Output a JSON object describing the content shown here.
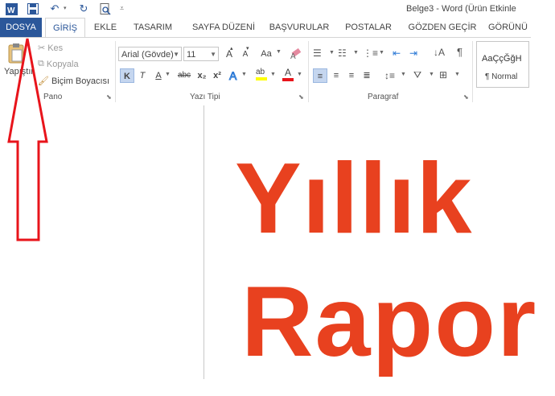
{
  "window": {
    "title": "Belge3 - Word (Ürün Etkinle"
  },
  "quick_access": {
    "icons": [
      "word-app-icon",
      "save-icon",
      "undo-icon",
      "redo-icon",
      "print-preview-icon",
      "customize-icon"
    ]
  },
  "tabs": [
    {
      "label": "DOSYA"
    },
    {
      "label": "GİRİŞ"
    },
    {
      "label": "EKLE"
    },
    {
      "label": "TASARIM"
    },
    {
      "label": "SAYFA DÜZENİ"
    },
    {
      "label": "BAŞVURULAR"
    },
    {
      "label": "POSTALAR"
    },
    {
      "label": "GÖZDEN GEÇİR"
    },
    {
      "label": "GÖRÜNÜ"
    }
  ],
  "clipboard": {
    "paste_label": "Yapıştır",
    "cut_label": "Kes",
    "copy_label": "Kopyala",
    "format_painter_label": "Biçim Boyacısı",
    "group_label": "Pano"
  },
  "font": {
    "font_name": "Arial (Gövde)",
    "font_size": "11",
    "grow_label": "A",
    "shrink_label": "A",
    "case_label": "Aa",
    "bold_label": "K",
    "italic_label": "T",
    "underline_label": "A",
    "strike_label": "abc",
    "subscript_label": "x₂",
    "superscript_label": "x²",
    "highlight_label": "ab",
    "font_color_label": "A",
    "group_label": "Yazı Tipi"
  },
  "paragraph": {
    "group_label": "Paragraf"
  },
  "styles": {
    "preview_text": "AaÇçĞğH",
    "style_name": "¶ Normal"
  },
  "document": {
    "line1": "Yıllık",
    "line2": "Rapor"
  },
  "annotation": {
    "arrow_color": "#e8141b"
  },
  "colors": {
    "file_tab": "#2b579a",
    "title_text": "#e8411f",
    "highlight": "#ffff00",
    "font_color": "#e8141b"
  }
}
